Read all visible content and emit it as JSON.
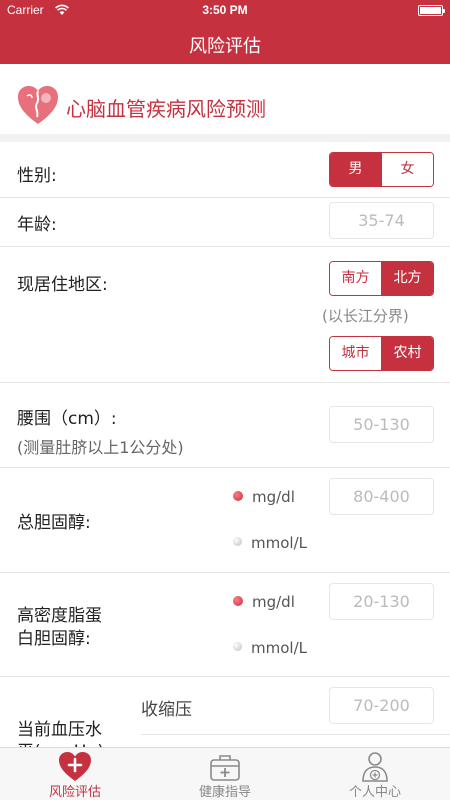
{
  "status_bar": {
    "carrier": "Carrier",
    "time": "3:50 PM"
  },
  "nav": {
    "title": "风险评估"
  },
  "banner": {
    "title": "心脑血管疾病风险预测"
  },
  "form": {
    "gender": {
      "label": "性别:",
      "options": [
        "男",
        "女"
      ],
      "selected": "男"
    },
    "age": {
      "label": "年龄:",
      "placeholder": "35-74"
    },
    "region": {
      "label": "现居住地区:",
      "options": [
        "南方",
        "北方"
      ],
      "selected": "北方",
      "note": "(以长江分界)",
      "area_options": [
        "城市",
        "农村"
      ],
      "area_selected": "农村"
    },
    "waist": {
      "label": "腰围（cm）:",
      "sublabel": "(测量肚脐以上1公分处)",
      "placeholder": "50-130"
    },
    "cholesterol": {
      "label": "总胆固醇:",
      "unit_options": [
        "mg/dl",
        "mmol/L"
      ],
      "unit_selected": "mg/dl",
      "placeholder": "80-400"
    },
    "hdl": {
      "label_line1": "高密度脂蛋",
      "label_line2": "白胆固醇:",
      "unit_options": [
        "mg/dl",
        "mmol/L"
      ],
      "unit_selected": "mg/dl",
      "placeholder": "20-130"
    },
    "blood_pressure": {
      "label_line1": "当前血压水",
      "label_line2": "平(mmHg):",
      "systolic_label": "收缩压",
      "systolic_placeholder": "70-200"
    }
  },
  "tabbar": {
    "tabs": [
      {
        "label": "风险评估",
        "icon": "heart-plus-icon",
        "active": true
      },
      {
        "label": "健康指导",
        "icon": "medical-kit-icon",
        "active": false
      },
      {
        "label": "个人中心",
        "icon": "user-plus-icon",
        "active": false
      }
    ]
  },
  "colors": {
    "accent": "#c6313f",
    "background": "#efeff4"
  }
}
